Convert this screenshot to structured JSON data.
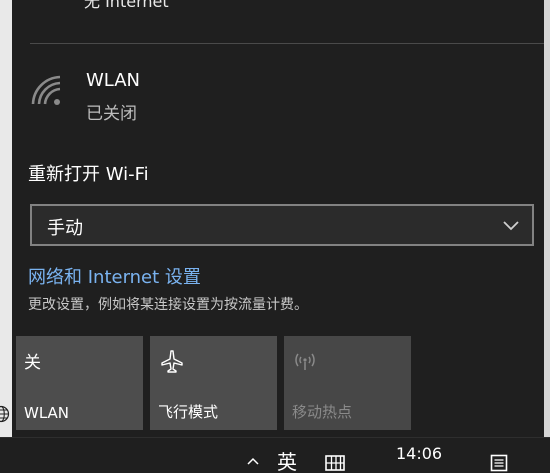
{
  "network": {
    "partial_row_text": "无 Internet",
    "wlan": {
      "name": "WLAN",
      "status": "已关闭",
      "icon": "wifi-off-icon"
    },
    "reopen_label": "重新打开 Wi-Fi",
    "reopen_select": {
      "value": "手动",
      "icon": "chevron-down-icon"
    },
    "settings_link": "网络和 Internet 设置",
    "settings_desc": "更改设置，例如将某连接设置为按流量计费。"
  },
  "quick_actions": [
    {
      "icon_text": "关",
      "label": "WLAN",
      "state": "off"
    },
    {
      "icon": "airplane-icon",
      "label": "飞行模式",
      "state": "off"
    },
    {
      "icon": "mobile-hotspot-icon",
      "label": "移动热点",
      "state": "disabled"
    }
  ],
  "taskbar": {
    "ime_label": "英",
    "clock_time": "14:06"
  },
  "colors": {
    "flyout_bg": "#1f1f1f",
    "tile_bg": "#4d4d4d",
    "link": "#7ab3f0",
    "text_secondary": "#bdbdbd"
  }
}
